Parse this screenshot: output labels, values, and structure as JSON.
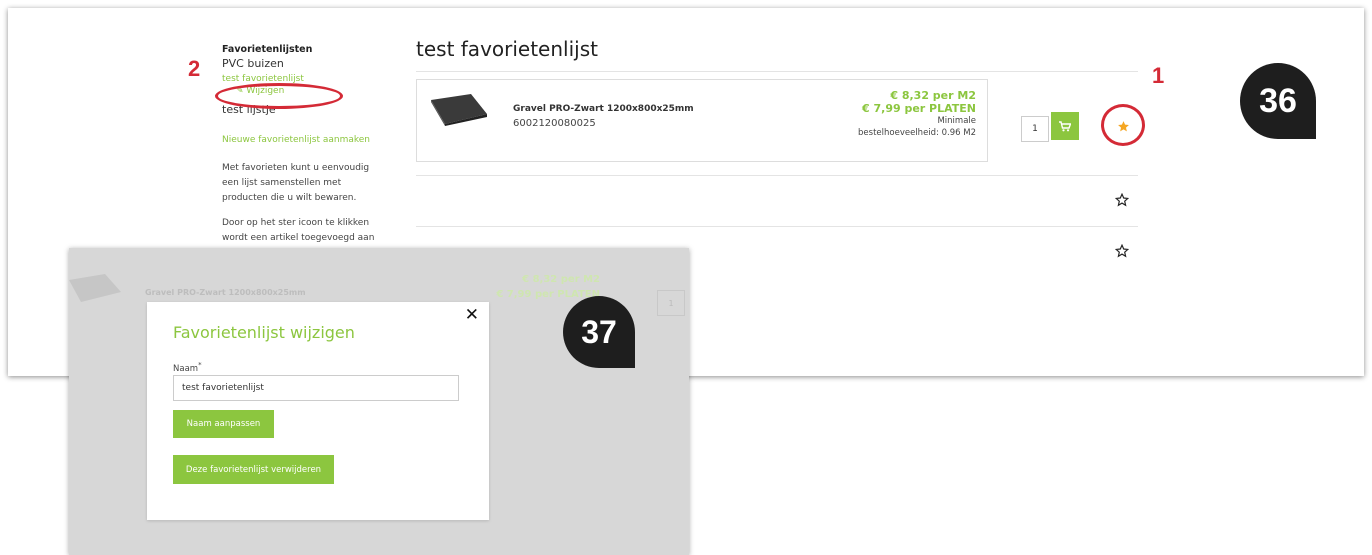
{
  "sidebar": {
    "heading": "Favorietenlijsten",
    "lists": [
      {
        "label": "PVC buizen"
      },
      {
        "label": "test favorietenlijst"
      },
      {
        "label": "test lijstje"
      }
    ],
    "edit_label": "Wijzigen",
    "new_list_label": "Nieuwe favorietenlijst aanmaken",
    "info": [
      "Met favorieten kunt u eenvoudig een lijst samenstellen met producten die u wilt bewaren.",
      "Door op het ster icoon te klikken wordt een artikel toegevoegd aan de"
    ]
  },
  "main": {
    "title": "test favorietenlijst",
    "product": {
      "name": "Gravel PRO-Zwart 1200x800x25mm",
      "code": "6002120080025",
      "price_m2": "€ 8,32 per M2",
      "price_plate": "€ 7,99 per PLATEN",
      "min_label": "Minimale",
      "min_value": "bestelhoeveelheid: 0.96 M2",
      "quantity": "1",
      "cart_icon": "cart-icon",
      "favorite_icon": "star-filled-icon"
    }
  },
  "annotations": {
    "marker1": "1",
    "marker2": "2",
    "badge36": "36",
    "badge37": "37"
  },
  "dialog": {
    "bg_product_name": "Gravel PRO-Zwart 1200x800x25mm",
    "bg_price_m2": "€ 8,32 per M2",
    "bg_price_plate": "€ 7,99 per PLATEN",
    "bg_quantity": "1",
    "bg_min_value": "bestelhoeveelheid",
    "title": "Favorietenlijst wijzigen",
    "close_icon": "close-icon",
    "name_label": "Naam",
    "name_required": "*",
    "name_value": "test favorietenlijst",
    "rename_button": "Naam aanpassen",
    "delete_button": "Deze favorietenlijst verwijderen"
  },
  "colors": {
    "accent": "#8cc63f",
    "annotation": "#d42a36",
    "badge": "#1e1e1e",
    "star": "#f5a623"
  }
}
